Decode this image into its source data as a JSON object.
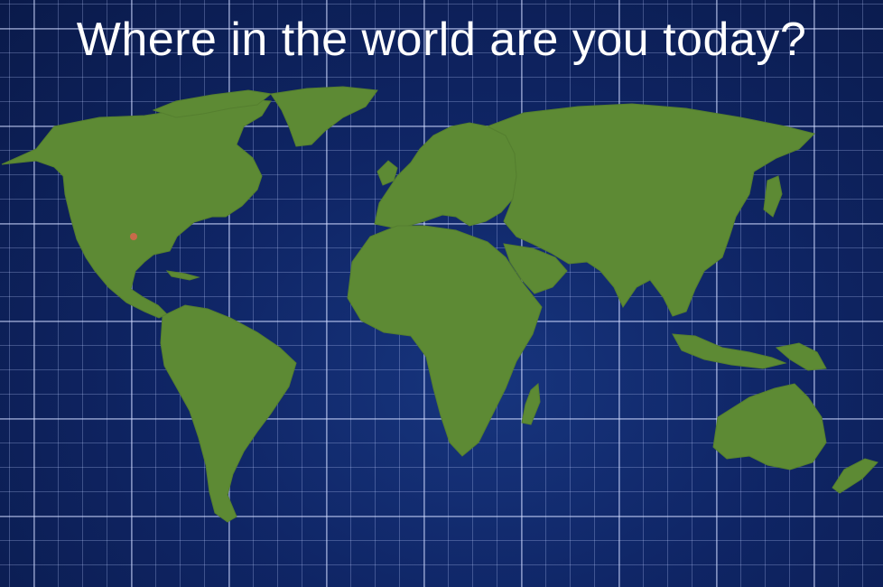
{
  "title": "Where in the world are you today?",
  "colors": {
    "ocean": "#0f2565",
    "grid": "#becdff",
    "land": "#5d8a34",
    "marker": "#c86a4a",
    "title_text": "#ffffff"
  },
  "marker": {
    "label": "",
    "region": "south-central United States"
  }
}
